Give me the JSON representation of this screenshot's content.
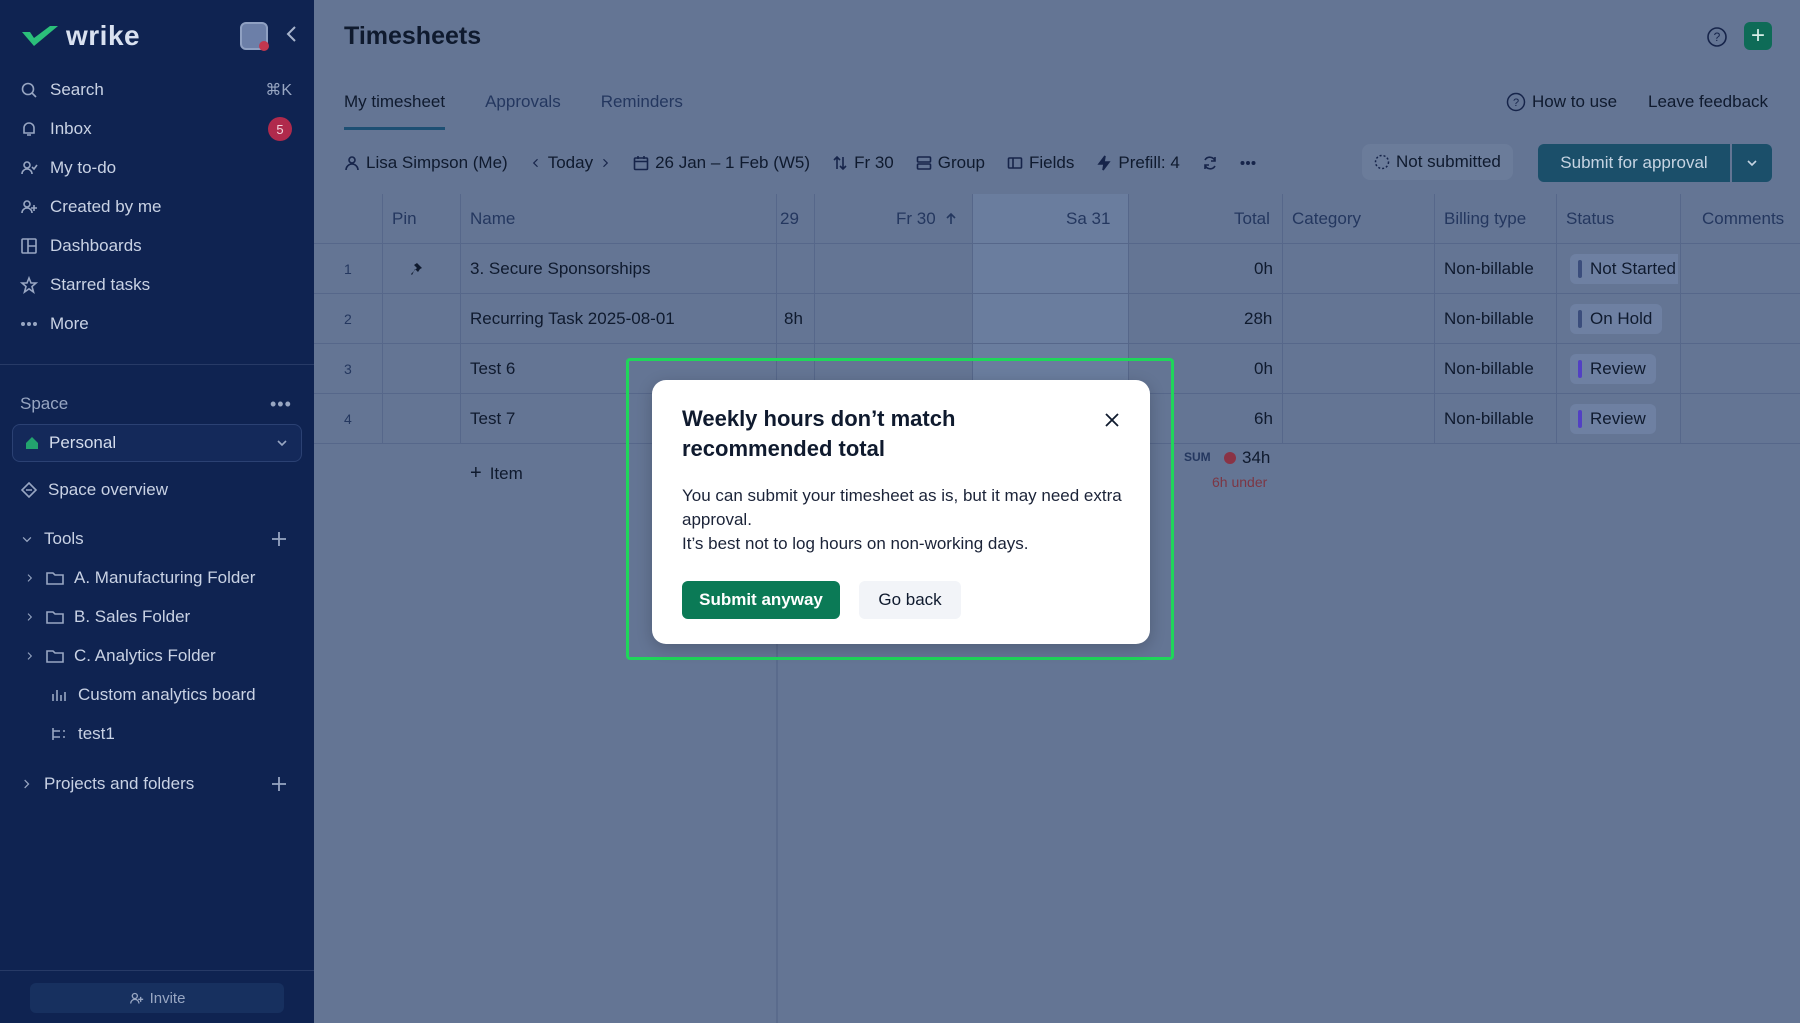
{
  "sidebar": {
    "logo": "wrike",
    "nav": [
      {
        "label": "Search",
        "shortcut": "⌘K"
      },
      {
        "label": "Inbox",
        "badge": "5"
      },
      {
        "label": "My to-do"
      },
      {
        "label": "Created by me"
      },
      {
        "label": "Dashboards"
      },
      {
        "label": "Starred tasks"
      },
      {
        "label": "More"
      }
    ],
    "space_label": "Space",
    "space_name": "Personal",
    "space_overview": "Space overview",
    "tools_label": "Tools",
    "tree": [
      "A. Manufacturing Folder",
      "B. Sales Folder",
      "C. Analytics Folder",
      "Custom analytics board",
      "test1"
    ],
    "projects_label": "Projects and folders",
    "invite": "Invite"
  },
  "main": {
    "title": "Timesheets",
    "tabs": [
      "My timesheet",
      "Approvals",
      "Reminders"
    ],
    "how_to": "How to use",
    "feedback": "Leave feedback",
    "toolbar": {
      "user": "Lisa Simpson (Me)",
      "today": "Today",
      "range": "26 Jan – 1 Feb (W5)",
      "sort": "Fr 30",
      "group": "Group",
      "fields": "Fields",
      "prefill": "Prefill: 4",
      "status": "Not submitted",
      "submit": "Submit for approval"
    },
    "columns": {
      "pin": "Pin",
      "name": "Name",
      "d29": "29",
      "fr30": "Fr 30",
      "sa31": "Sa 31",
      "total": "Total",
      "category": "Category",
      "billing": "Billing type",
      "status": "Status",
      "comments": "Comments"
    },
    "rows": [
      {
        "num": "1",
        "name": "3. Secure Sponsorships",
        "d29": "",
        "total": "0h",
        "billing": "Non-billable",
        "status": "Not Started",
        "pinned": true
      },
      {
        "num": "2",
        "name": "Recurring Task 2025-08-01",
        "d29": "8h",
        "total": "28h",
        "billing": "Non-billable",
        "status": "On Hold",
        "pinned": false
      },
      {
        "num": "3",
        "name": "Test 6",
        "d29": "",
        "total": "0h",
        "billing": "Non-billable",
        "status": "Review",
        "pinned": false
      },
      {
        "num": "4",
        "name": "Test 7",
        "d29": "",
        "total": "6h",
        "billing": "Non-billable",
        "status": "Review",
        "pinned": false
      }
    ],
    "add_item": "Item",
    "sum_label": "SUM",
    "sum_value": "34h",
    "under": "6h under"
  },
  "modal": {
    "title": "Weekly hours don’t match recommended total",
    "body_line1": "You can submit your timesheet as is, but it may need extra approval.",
    "body_line2": "It’s best not to log hours on non-working days.",
    "primary": "Submit anyway",
    "secondary": "Go back"
  }
}
